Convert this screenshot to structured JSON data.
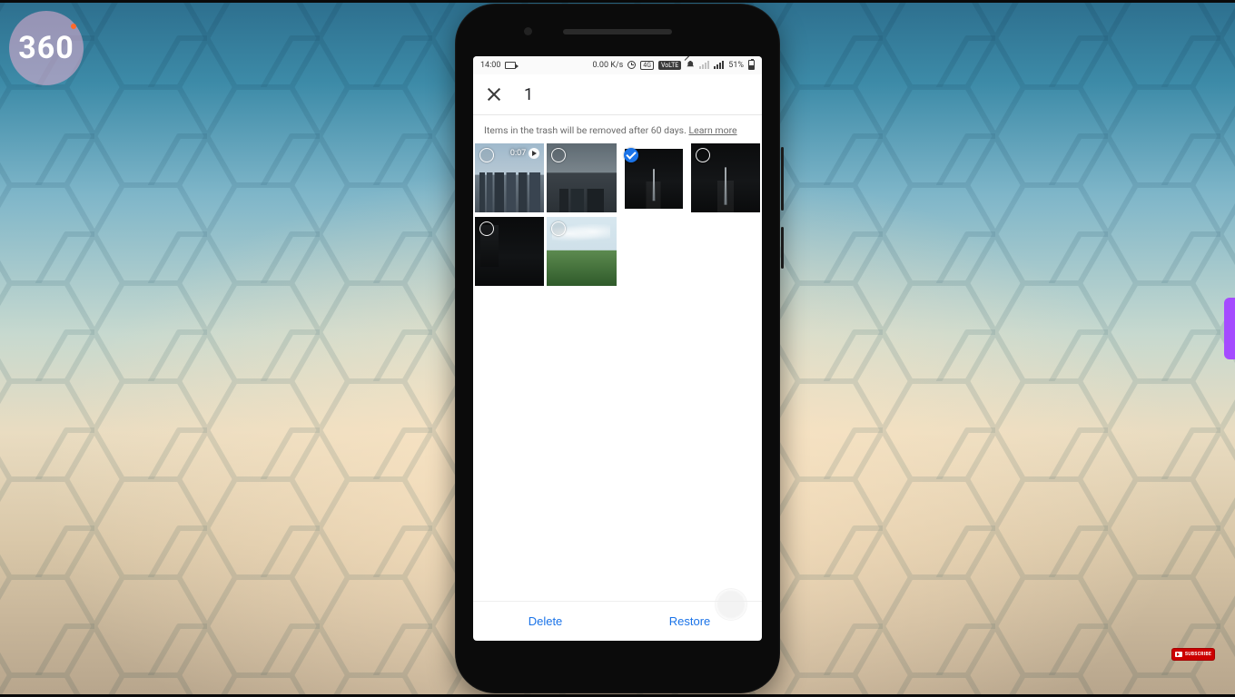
{
  "badge": {
    "text": "360"
  },
  "subscribe": {
    "label": "SUBSCRIBE"
  },
  "statusbar": {
    "time": "14:00",
    "net_speed": "0.00 K/s",
    "volte_label": "VoLTE",
    "fourg_label": "4G",
    "battery_pct": "51%"
  },
  "toolbar": {
    "selected_count": "1"
  },
  "notice": {
    "text": "Items in the trash will be removed after 60 days. ",
    "learn_more": "Learn more"
  },
  "thumbs": {
    "video_duration": "0:07"
  },
  "actions": {
    "delete": "Delete",
    "restore": "Restore"
  }
}
